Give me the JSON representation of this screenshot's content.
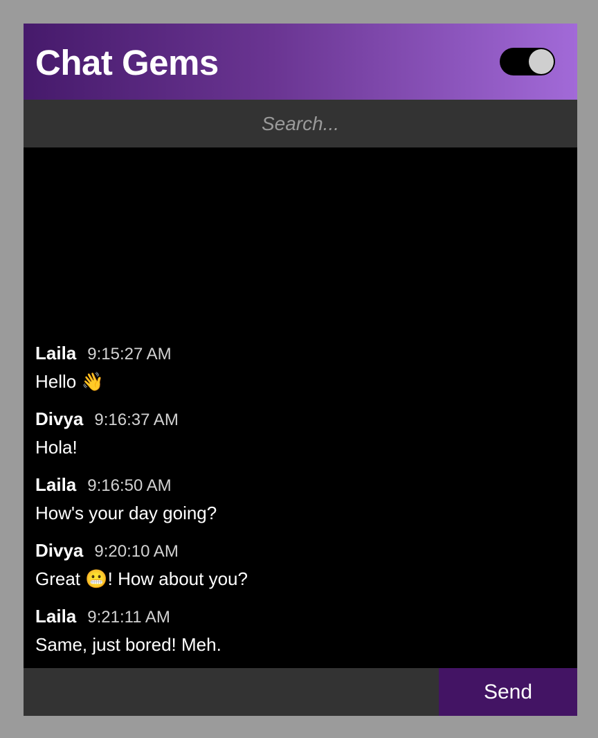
{
  "app": {
    "title": "Chat Gems",
    "toggle_on": true
  },
  "search": {
    "placeholder": "Search..."
  },
  "messages": [
    {
      "author": "Laila",
      "time": "9:15:27 AM",
      "text": "Hello 👋"
    },
    {
      "author": "Divya",
      "time": "9:16:37 AM",
      "text": "Hola!"
    },
    {
      "author": "Laila",
      "time": "9:16:50 AM",
      "text": "How's your day going?"
    },
    {
      "author": "Divya",
      "time": "9:20:10 AM",
      "text": "Great 😬! How about you?"
    },
    {
      "author": "Laila",
      "time": "9:21:11 AM",
      "text": "Same, just bored! Meh."
    }
  ],
  "composer": {
    "value": "",
    "send_label": "Send"
  },
  "colors": {
    "accent": "#431464",
    "header_gradient_start": "#461a6b",
    "header_gradient_end": "#a26ad8",
    "panel": "#333333"
  }
}
